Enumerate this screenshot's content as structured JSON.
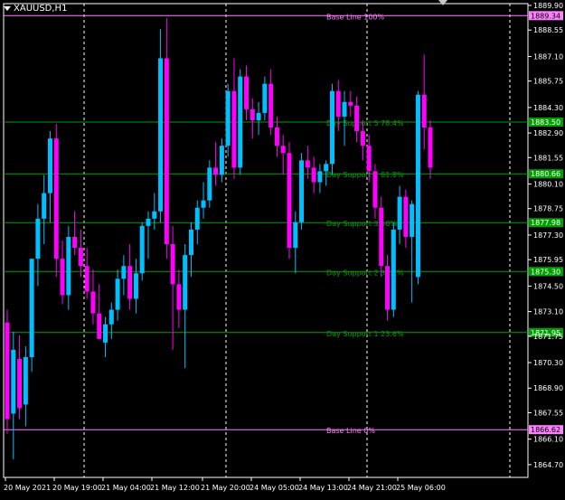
{
  "window": {
    "symbol_title": "XAUUSD,H1"
  },
  "colors": {
    "background": "#000000",
    "frame": "#ffffff",
    "grid": "#ffffff",
    "bull_candle": "#00bfff",
    "bear_candle": "#ff00ff",
    "support_line": "#00a000",
    "base_line": "#ff80ff",
    "axis_text": "#ffffff"
  },
  "chart_data": {
    "type": "candlestick",
    "title": "XAUUSD,H1",
    "ylim": [
      1864.0,
      1890.0
    ],
    "y_ticks": [
      "1889.90",
      "1888.55",
      "1887.10",
      "1885.75",
      "1884.30",
      "1882.90",
      "1881.55",
      "1880.10",
      "1878.75",
      "1877.30",
      "1875.95",
      "1874.50",
      "1873.10",
      "1871.75",
      "1870.30",
      "1868.90",
      "1867.55",
      "1866.10",
      "1864.70"
    ],
    "x_ticks": [
      "20 May 2021",
      "20 May 19:00",
      "21 May 04:00",
      "21 May 12:00",
      "21 May 20:00",
      "24 May 05:00",
      "24 May 13:00",
      "24 May 21:00",
      "25 May 06:00"
    ],
    "levels": [
      {
        "price": 1889.34,
        "label": "Base Line 100%",
        "kind": "base",
        "price_label": "1889.34"
      },
      {
        "price": 1883.5,
        "label": "Day Support 5 78.4%",
        "kind": "support",
        "price_label": "1883.50"
      },
      {
        "price": 1880.66,
        "label": "Day Support 4 61.8%",
        "kind": "support",
        "price_label": "1880.66"
      },
      {
        "price": 1877.98,
        "label": "Day Support 3 50%",
        "kind": "support",
        "price_label": "1877.98"
      },
      {
        "price": 1875.3,
        "label": "Day Support 2 38.2%",
        "kind": "support",
        "price_label": "1875.30"
      },
      {
        "price": 1871.95,
        "label": "Day Support 1 23.6%",
        "kind": "support",
        "price_label": "1871.95"
      },
      {
        "price": 1866.62,
        "label": "Base Line 0%",
        "kind": "base",
        "price_label": "1866.62"
      }
    ],
    "candles": [
      {
        "o": 1872.5,
        "h": 1873.2,
        "l": 1866.4,
        "c": 1867.2
      },
      {
        "o": 1867.5,
        "h": 1872.0,
        "l": 1865.0,
        "c": 1871.0
      },
      {
        "o": 1870.5,
        "h": 1871.8,
        "l": 1867.2,
        "c": 1867.8
      },
      {
        "o": 1868.0,
        "h": 1871.2,
        "l": 1866.8,
        "c": 1870.6
      },
      {
        "o": 1870.6,
        "h": 1874.2,
        "l": 1869.8,
        "c": 1876.0
      },
      {
        "o": 1876.0,
        "h": 1879.0,
        "l": 1874.5,
        "c": 1878.2
      },
      {
        "o": 1878.2,
        "h": 1880.6,
        "l": 1876.8,
        "c": 1879.6
      },
      {
        "o": 1879.6,
        "h": 1883.0,
        "l": 1878.0,
        "c": 1882.6
      },
      {
        "o": 1882.6,
        "h": 1883.4,
        "l": 1875.0,
        "c": 1876.0
      },
      {
        "o": 1876.0,
        "h": 1877.0,
        "l": 1873.5,
        "c": 1874.0
      },
      {
        "o": 1874.0,
        "h": 1877.8,
        "l": 1873.2,
        "c": 1877.2
      },
      {
        "o": 1877.2,
        "h": 1878.6,
        "l": 1876.2,
        "c": 1876.6
      },
      {
        "o": 1876.6,
        "h": 1877.6,
        "l": 1875.0,
        "c": 1875.6
      },
      {
        "o": 1875.6,
        "h": 1876.6,
        "l": 1873.8,
        "c": 1874.2
      },
      {
        "o": 1874.2,
        "h": 1875.4,
        "l": 1872.4,
        "c": 1873.0
      },
      {
        "o": 1873.0,
        "h": 1874.6,
        "l": 1871.8,
        "c": 1871.6
      },
      {
        "o": 1871.4,
        "h": 1872.8,
        "l": 1870.6,
        "c": 1872.4
      },
      {
        "o": 1872.4,
        "h": 1873.6,
        "l": 1871.6,
        "c": 1873.2
      },
      {
        "o": 1873.2,
        "h": 1875.4,
        "l": 1872.6,
        "c": 1874.9
      },
      {
        "o": 1874.9,
        "h": 1876.2,
        "l": 1874.0,
        "c": 1875.6
      },
      {
        "o": 1875.6,
        "h": 1876.8,
        "l": 1873.2,
        "c": 1873.8
      },
      {
        "o": 1873.8,
        "h": 1876.0,
        "l": 1873.0,
        "c": 1875.2
      },
      {
        "o": 1875.2,
        "h": 1878.0,
        "l": 1874.8,
        "c": 1877.8
      },
      {
        "o": 1877.8,
        "h": 1878.6,
        "l": 1876.0,
        "c": 1878.2
      },
      {
        "o": 1878.2,
        "h": 1879.6,
        "l": 1877.6,
        "c": 1878.6
      },
      {
        "o": 1878.6,
        "h": 1888.6,
        "l": 1878.0,
        "c": 1887.0
      },
      {
        "o": 1887.0,
        "h": 1889.2,
        "l": 1876.0,
        "c": 1876.8
      },
      {
        "o": 1876.8,
        "h": 1877.8,
        "l": 1871.0,
        "c": 1874.6
      },
      {
        "o": 1874.6,
        "h": 1875.4,
        "l": 1872.2,
        "c": 1873.2
      },
      {
        "o": 1873.2,
        "h": 1876.8,
        "l": 1870.0,
        "c": 1876.2
      },
      {
        "o": 1876.2,
        "h": 1878.0,
        "l": 1875.0,
        "c": 1877.6
      },
      {
        "o": 1877.6,
        "h": 1879.2,
        "l": 1876.8,
        "c": 1878.8
      },
      {
        "o": 1878.8,
        "h": 1880.2,
        "l": 1878.2,
        "c": 1879.2
      },
      {
        "o": 1879.2,
        "h": 1881.4,
        "l": 1878.8,
        "c": 1881.0
      },
      {
        "o": 1881.0,
        "h": 1882.4,
        "l": 1880.0,
        "c": 1880.6
      },
      {
        "o": 1880.6,
        "h": 1882.6,
        "l": 1880.2,
        "c": 1882.2
      },
      {
        "o": 1882.2,
        "h": 1885.6,
        "l": 1881.6,
        "c": 1885.2
      },
      {
        "o": 1885.2,
        "h": 1887.0,
        "l": 1880.4,
        "c": 1881.0
      },
      {
        "o": 1881.0,
        "h": 1886.4,
        "l": 1880.6,
        "c": 1886.0
      },
      {
        "o": 1886.0,
        "h": 1886.6,
        "l": 1883.6,
        "c": 1884.2
      },
      {
        "o": 1884.2,
        "h": 1884.8,
        "l": 1882.6,
        "c": 1883.6
      },
      {
        "o": 1883.6,
        "h": 1884.6,
        "l": 1882.8,
        "c": 1884.0
      },
      {
        "o": 1884.0,
        "h": 1886.0,
        "l": 1883.6,
        "c": 1885.6
      },
      {
        "o": 1885.6,
        "h": 1886.4,
        "l": 1882.8,
        "c": 1883.2
      },
      {
        "o": 1883.2,
        "h": 1883.8,
        "l": 1881.6,
        "c": 1882.2
      },
      {
        "o": 1882.2,
        "h": 1882.8,
        "l": 1880.6,
        "c": 1881.8
      },
      {
        "o": 1881.8,
        "h": 1882.4,
        "l": 1876.0,
        "c": 1876.6
      },
      {
        "o": 1876.6,
        "h": 1878.6,
        "l": 1875.2,
        "c": 1878.0
      },
      {
        "o": 1878.0,
        "h": 1881.8,
        "l": 1877.6,
        "c": 1881.4
      },
      {
        "o": 1881.4,
        "h": 1882.2,
        "l": 1880.4,
        "c": 1881.0
      },
      {
        "o": 1881.0,
        "h": 1881.6,
        "l": 1879.6,
        "c": 1880.2
      },
      {
        "o": 1880.2,
        "h": 1881.2,
        "l": 1879.6,
        "c": 1880.8
      },
      {
        "o": 1880.8,
        "h": 1881.4,
        "l": 1880.0,
        "c": 1881.2
      },
      {
        "o": 1881.2,
        "h": 1885.6,
        "l": 1880.6,
        "c": 1885.2
      },
      {
        "o": 1885.2,
        "h": 1885.8,
        "l": 1883.0,
        "c": 1883.8
      },
      {
        "o": 1883.8,
        "h": 1885.2,
        "l": 1882.2,
        "c": 1884.6
      },
      {
        "o": 1884.6,
        "h": 1885.2,
        "l": 1883.8,
        "c": 1884.4
      },
      {
        "o": 1884.4,
        "h": 1884.9,
        "l": 1882.4,
        "c": 1883.0
      },
      {
        "o": 1883.0,
        "h": 1883.6,
        "l": 1881.4,
        "c": 1882.2
      },
      {
        "o": 1882.2,
        "h": 1882.8,
        "l": 1880.2,
        "c": 1880.8
      },
      {
        "o": 1880.8,
        "h": 1881.2,
        "l": 1878.2,
        "c": 1878.8
      },
      {
        "o": 1878.8,
        "h": 1879.4,
        "l": 1875.0,
        "c": 1875.6
      },
      {
        "o": 1875.6,
        "h": 1876.2,
        "l": 1872.6,
        "c": 1873.2
      },
      {
        "o": 1873.2,
        "h": 1878.0,
        "l": 1872.8,
        "c": 1877.6
      },
      {
        "o": 1877.6,
        "h": 1880.0,
        "l": 1876.8,
        "c": 1879.4
      },
      {
        "o": 1879.4,
        "h": 1879.8,
        "l": 1876.6,
        "c": 1877.2
      },
      {
        "o": 1877.2,
        "h": 1879.2,
        "l": 1873.6,
        "c": 1879.0
      },
      {
        "o": 1875.0,
        "h": 1885.2,
        "l": 1874.6,
        "c": 1885.0
      },
      {
        "o": 1885.0,
        "h": 1887.2,
        "l": 1882.0,
        "c": 1883.2
      },
      {
        "o": 1883.2,
        "h": 1883.6,
        "l": 1880.4,
        "c": 1881.0
      }
    ]
  }
}
